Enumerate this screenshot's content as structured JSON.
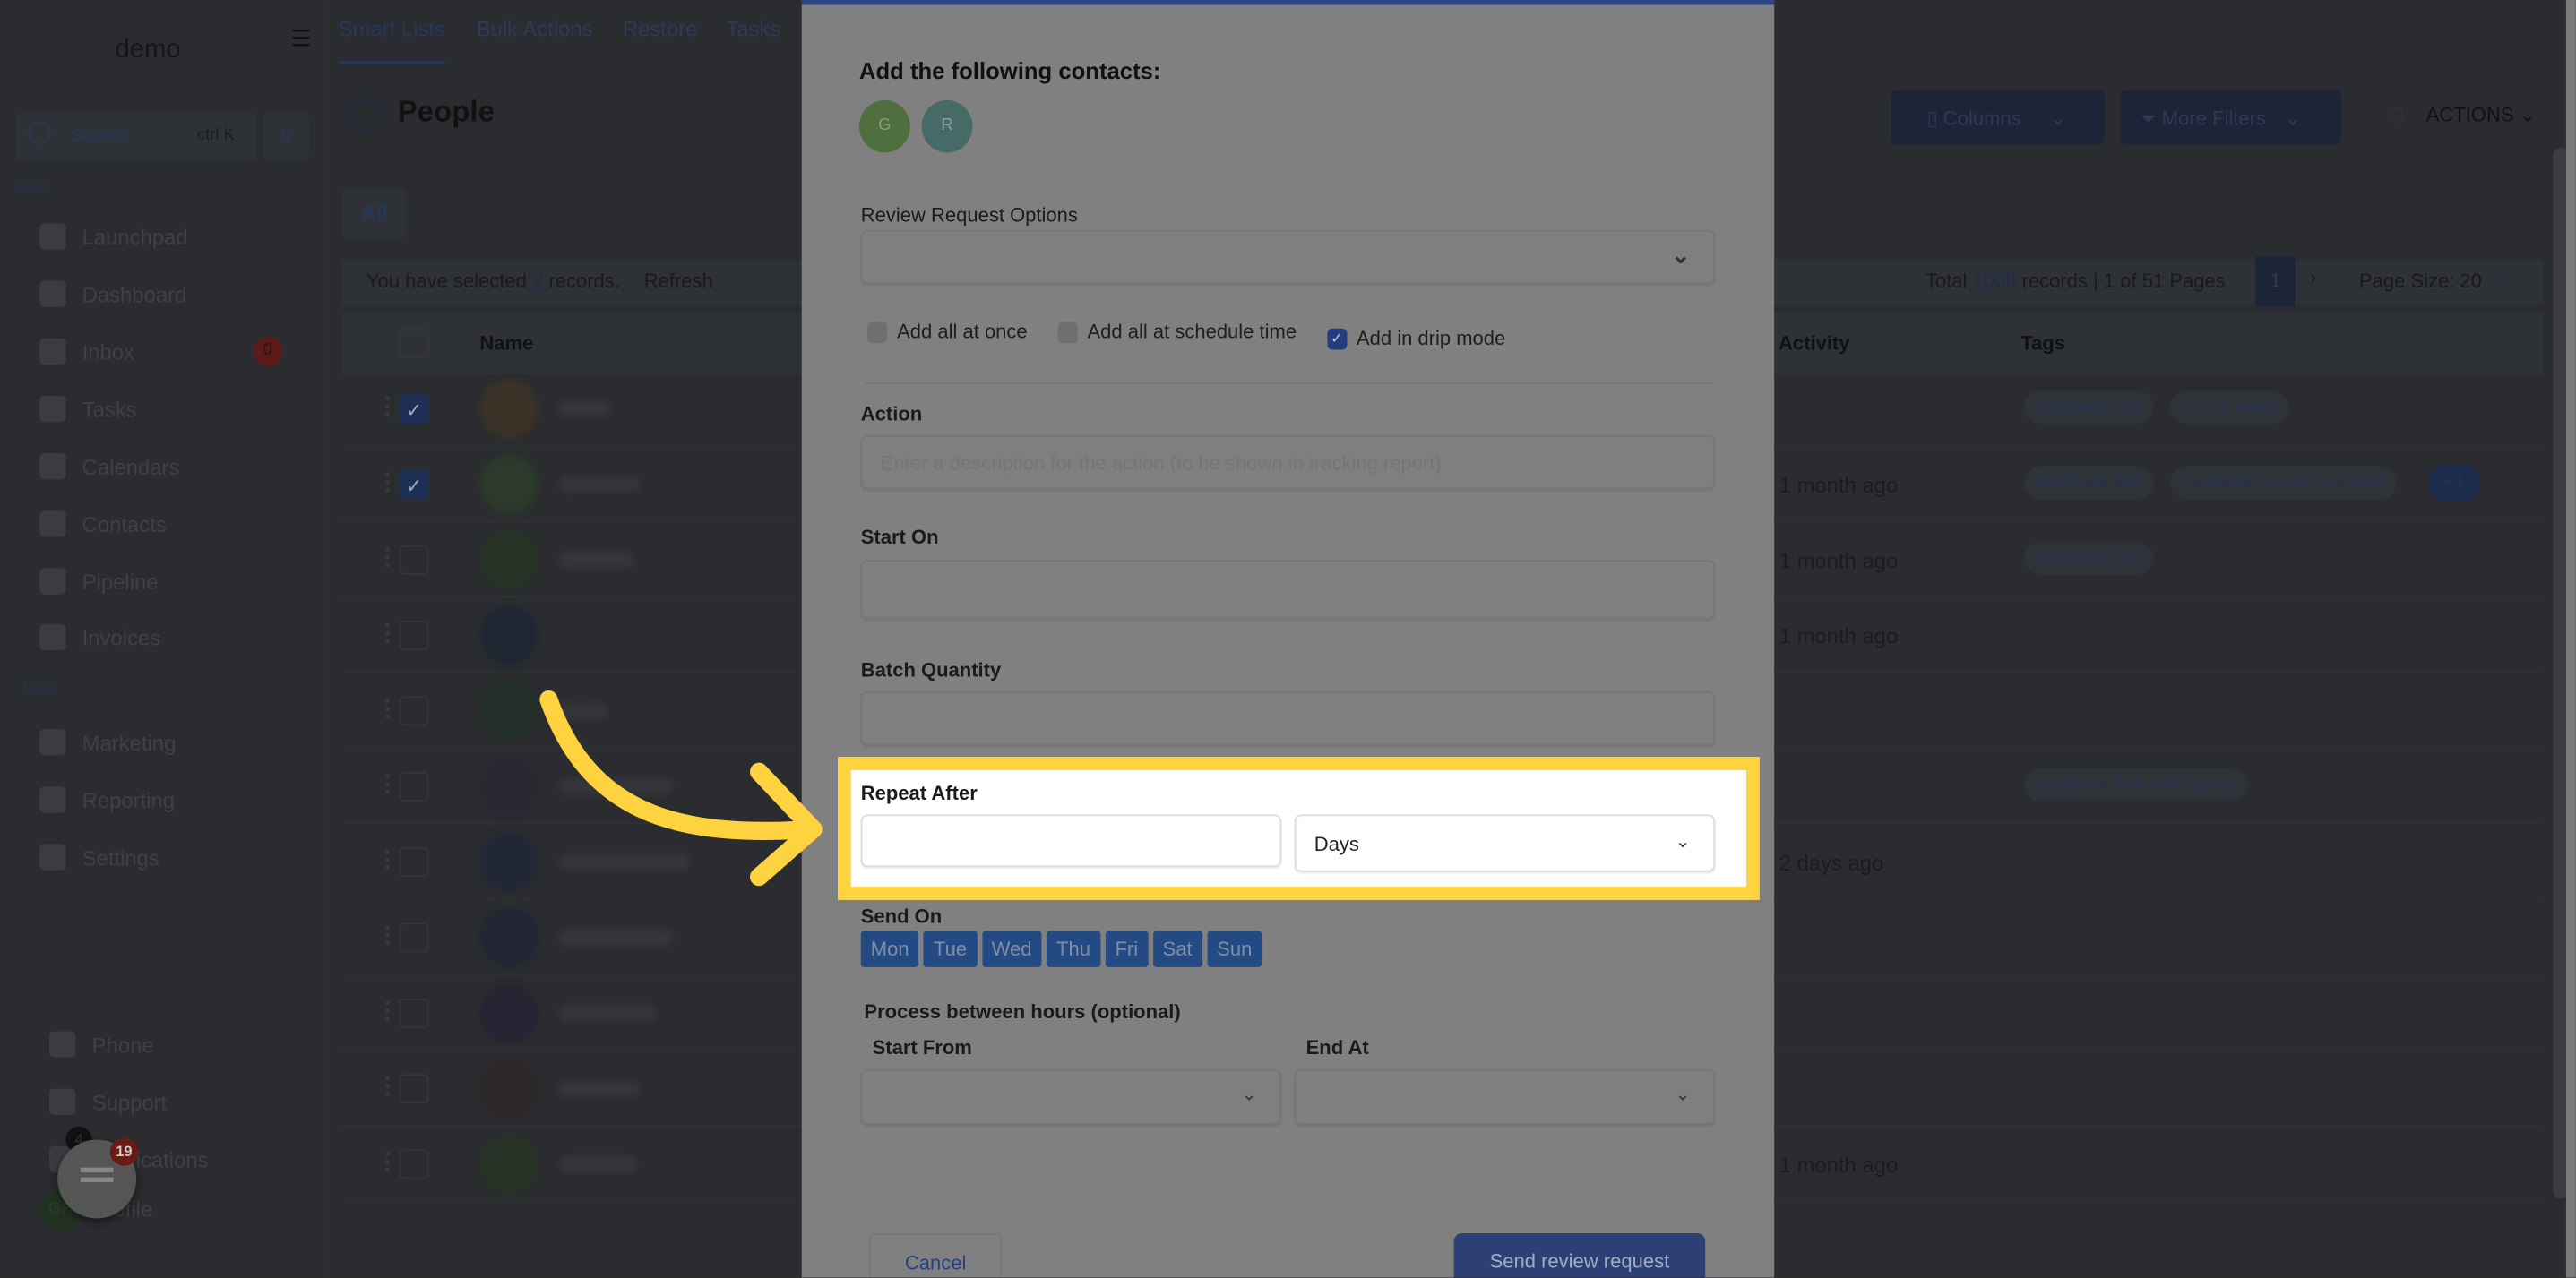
{
  "app": {
    "logo": "demo",
    "tabs": [
      "Smart Lists",
      "Bulk Actions",
      "Restore",
      "Tasks"
    ],
    "page_title": "People"
  },
  "sidebar": {
    "search_label": "Search",
    "search_shortcut": "ctrl K",
    "apps_label": "Apps",
    "tools_label": "Tools",
    "items": [
      "Launchpad",
      "Dashboard",
      "Inbox",
      "Tasks",
      "Calendars",
      "Contacts",
      "Pipeline",
      "Invoices"
    ],
    "inbox_badge": "0",
    "tools": [
      "Marketing",
      "Reporting",
      "Settings"
    ],
    "bottom": [
      "Phone",
      "Support",
      "Notifications",
      "Profile"
    ],
    "notifications_badge": "4",
    "profile_initials": "GH",
    "chat_badge": "19"
  },
  "toolbar": {
    "columns": "Columns",
    "more_filters": "More Filters",
    "actions": "ACTIONS"
  },
  "list": {
    "filter_tab": "All",
    "selected_text": "You have selected",
    "selected_count": "2",
    "selected_suffix": "records.",
    "refresh": "Refresh",
    "total_prefix": "Total",
    "total": "1008",
    "total_mid": "records |",
    "page": "1",
    "pages_suffix": "of 51 Pages",
    "current_page": "1",
    "page_size": "Page Size: 20",
    "headers": {
      "name": "Name",
      "activity": "Last Activity",
      "tags": "Tags"
    },
    "rows": [
      {
        "checked": true,
        "activity": "",
        "tags": [
          "facebook ads",
          "tik tok leads"
        ]
      },
      {
        "checked": true,
        "activity": "1 month ago",
        "tags": [
          "facebook ads",
          "facebook group post lead"
        ],
        "more": "+1"
      },
      {
        "checked": false,
        "activity": "1 month ago",
        "tags": [
          "facebook ads"
        ]
      },
      {
        "checked": false,
        "activity": "1 month ago",
        "tags": []
      },
      {
        "checked": false,
        "activity": "",
        "tags": []
      },
      {
        "checked": false,
        "activity": "",
        "tags": [
          "facebook free offer opt in"
        ]
      },
      {
        "checked": false,
        "activity": "2 days ago",
        "tags": []
      },
      {
        "checked": false,
        "activity": "",
        "tags": []
      },
      {
        "checked": false,
        "activity": "",
        "tags": []
      },
      {
        "checked": false,
        "activity": "",
        "tags": []
      },
      {
        "checked": false,
        "activity": "1 month ago",
        "tags": []
      }
    ]
  },
  "modal": {
    "heading": "Add the following contacts:",
    "contacts": [
      {
        "initial": "G",
        "color": "#4f6f3f"
      },
      {
        "initial": "R",
        "color": "#466a66"
      }
    ],
    "review_options_label": "Review Request Options",
    "review_options_value": "",
    "modes": [
      {
        "label": "Add all at once",
        "checked": false
      },
      {
        "label": "Add all at schedule time",
        "checked": false
      },
      {
        "label": "Add in drip mode",
        "checked": true
      }
    ],
    "action_label": "Action",
    "action_placeholder": "Enter a description for the action (to be shown in tracking report)",
    "start_on_label": "Start On",
    "batch_label": "Batch Quantity",
    "repeat_label": "Repeat After",
    "repeat_value": "",
    "repeat_unit": "Days",
    "send_on_label": "Send On",
    "days": [
      "Mon",
      "Tue",
      "Wed",
      "Thu",
      "Fri",
      "Sat",
      "Sun"
    ],
    "hours_label": "Process between hours (optional)",
    "start_from_label": "Start From",
    "end_at_label": "End At",
    "cancel": "Cancel",
    "submit": "Send review request"
  },
  "colors": {
    "highlight": "#ffd23f",
    "accent": "#2d4584",
    "day_button": "#234a82"
  }
}
